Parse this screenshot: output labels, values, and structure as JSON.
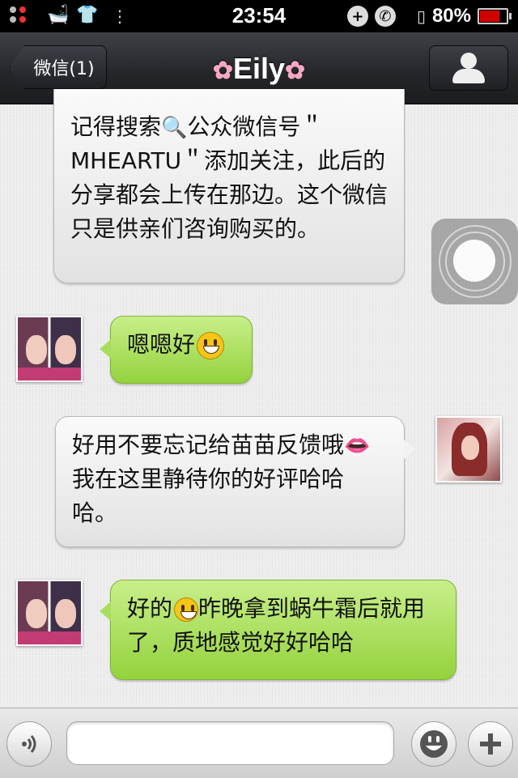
{
  "status_bar": {
    "time": "23:54",
    "battery_percent": "80%",
    "battery_level": 0.8,
    "battery_color": "#d00000"
  },
  "nav": {
    "back_label": "微信(1)",
    "title": "Eily",
    "title_decoration_icon": "cherry-blossom-icon",
    "profile_icon": "person-icon"
  },
  "messages": [
    {
      "side": "right",
      "text_before": "记得搜索",
      "inline_icon": "magnifying-glass-icon",
      "text_after": "公众微信号＂MHEARTU＂添加关注，此后的分享都会上传在那边。这个微信只是供亲们咨询购买的。"
    },
    {
      "side": "left",
      "text_before": "嗯嗯好",
      "inline_icon": "smiley-icon"
    },
    {
      "side": "right",
      "text_before": "好用不要忘记给苗苗反馈哦",
      "inline_icon": "lips-icon",
      "text_after": "我在这里静待你的好评哈哈哈。"
    },
    {
      "side": "left",
      "text_before": "好的",
      "inline_icon": "blushing-smiley-icon",
      "text_after": "昨晚拿到蜗牛霜后就用了，质地感觉好好哈哈"
    }
  ],
  "input_bar": {
    "voice_icon": "voice-icon",
    "text_value": "",
    "emoji_icon": "emoji-face-icon",
    "add_icon": "plus-icon"
  },
  "colors": {
    "outgoing_bubble": "#94d23d",
    "incoming_bubble": "#e2e2e2",
    "nav_background": "#25272b"
  }
}
